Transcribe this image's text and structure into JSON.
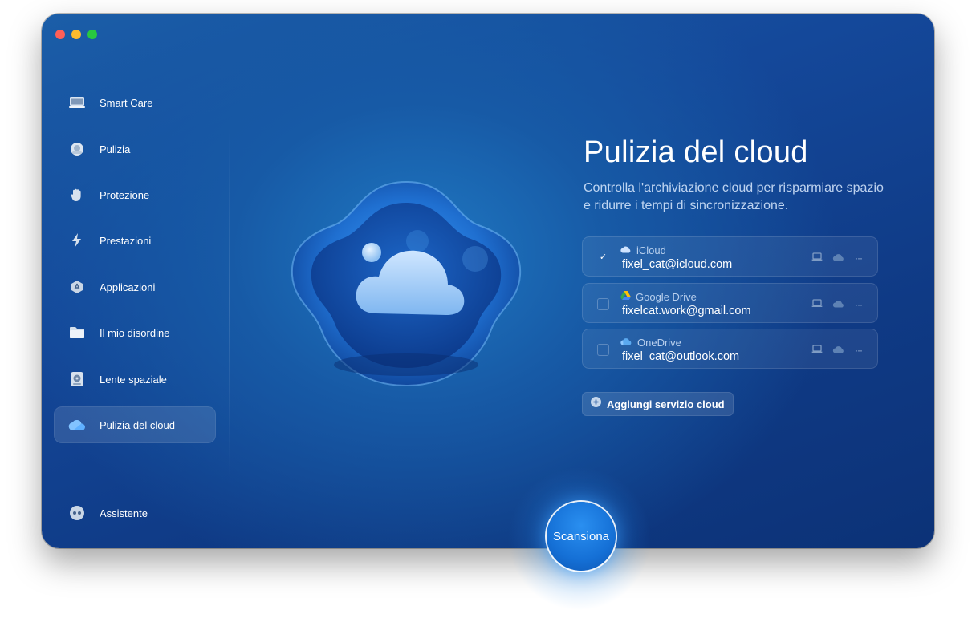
{
  "sidebar": {
    "items": [
      {
        "label": "Smart Care",
        "icon": "monitor-icon"
      },
      {
        "label": "Pulizia",
        "icon": "cleanup-icon"
      },
      {
        "label": "Protezione",
        "icon": "hand-icon"
      },
      {
        "label": "Prestazioni",
        "icon": "lightning-icon"
      },
      {
        "label": "Applicazioni",
        "icon": "apps-icon"
      },
      {
        "label": "Il mio disordine",
        "icon": "folder-icon"
      },
      {
        "label": "Lente spaziale",
        "icon": "disk-icon"
      },
      {
        "label": "Pulizia del cloud",
        "icon": "cloud-icon",
        "active": true
      }
    ],
    "assistant_label": "Assistente"
  },
  "main": {
    "title": "Pulizia del cloud",
    "subtitle": "Controlla l'archiviazione cloud per risparmiare spazio e ridurre i tempi di sincronizzazione.",
    "services": [
      {
        "name": "iCloud",
        "account": "fixel_cat@icloud.com",
        "checked": true,
        "icon": "icloud-icon"
      },
      {
        "name": "Google Drive",
        "account": "fixelcat.work@gmail.com",
        "checked": false,
        "icon": "google-drive-icon"
      },
      {
        "name": "OneDrive",
        "account": "fixel_cat@outlook.com",
        "checked": false,
        "icon": "onedrive-icon"
      }
    ],
    "check_mark": "✓",
    "more_glyph": "···",
    "add_service_label": "Aggiungi servizio cloud",
    "scan_label": "Scansiona"
  },
  "colors": {
    "accent": "#1570d6",
    "background": "#14489a"
  }
}
